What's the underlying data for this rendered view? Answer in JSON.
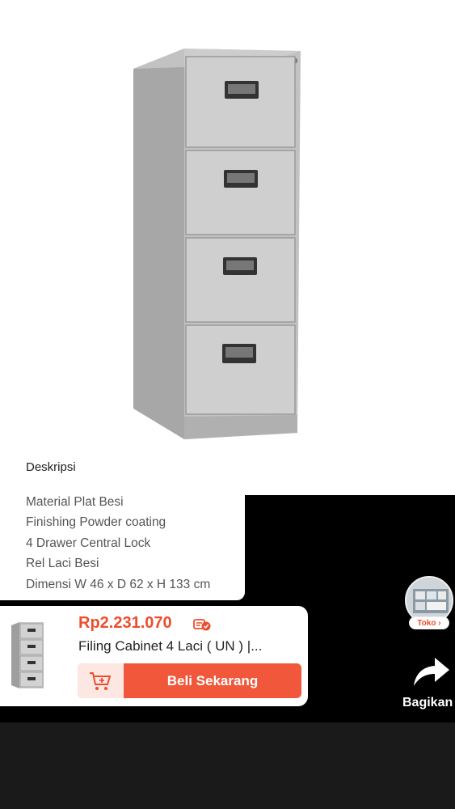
{
  "description": {
    "title": "Deskripsi",
    "lines": [
      "Material Plat Besi",
      "Finishing Powder coating",
      "4 Drawer Central Lock",
      "Rel Laci Besi",
      "Dimensi W 46 x D 62 x H 133 cm"
    ]
  },
  "shop": {
    "badge": "Toko ›"
  },
  "product": {
    "price": "Rp2.231.070",
    "title": "Filing Cabinet 4 Laci ( UN ) |...",
    "buy_label": "Beli Sekarang"
  },
  "share": {
    "label": "Bagikan"
  },
  "colors": {
    "accent": "#ee4d2d",
    "button": "#f0573b",
    "cabinet": "#c4c4c4"
  }
}
